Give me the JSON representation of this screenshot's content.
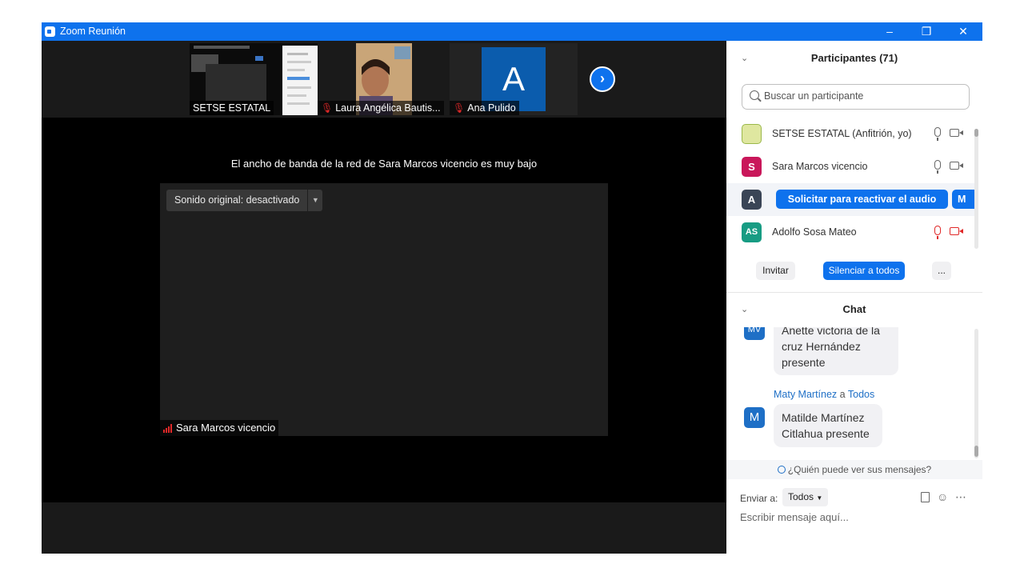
{
  "window": {
    "title": "Zoom Reunión"
  },
  "titlebar": {
    "minimize_icon": "minimize-icon",
    "restore_icon": "restore-icon",
    "close_icon": "close-icon"
  },
  "thumbnails": [
    {
      "name": "SETSE ESTATAL",
      "muted": false
    },
    {
      "name": "Laura Angélica Bautis...",
      "muted": true
    },
    {
      "name": "Ana Pulido",
      "muted": true,
      "avatar_letter": "A"
    }
  ],
  "meeting": {
    "bandwidth_notice": "El ancho de banda de la red de Sara Marcos vicencio es muy bajo",
    "original_sound": "Sonido original: desactivado",
    "speaker_name": "Sara Marcos vicencio"
  },
  "participants": {
    "title": "Participantes (71)",
    "search_placeholder": "Buscar un participante",
    "list": [
      {
        "name": "SETSE ESTATAL (Anfitrión, yo)",
        "avatar": "",
        "color": "#c8d96a"
      },
      {
        "name": "Sara Marcos vicencio",
        "avatar": "S",
        "color": "#c9175a"
      },
      {
        "name": "",
        "avatar": "A",
        "color": "#3a4556"
      },
      {
        "name": "Adolfo Sosa Mateo",
        "avatar": "AS",
        "color": "#179c83"
      }
    ],
    "request_audio_label": "Solicitar para reactivar el audio",
    "request_more_label": "M",
    "invite_label": "Invitar",
    "mute_all_label": "Silenciar a todos",
    "more_label": "..."
  },
  "chat": {
    "title": "Chat",
    "messages": [
      {
        "avatar": "MV",
        "text_lines": [
          "Anette victoria de la",
          "cruz Hernández",
          "presente"
        ]
      },
      {
        "sender": "Maty Martínez",
        "connector": "a",
        "recipient": "Todos",
        "avatar": "M",
        "text_lines": [
          "Matilde Martínez",
          "Citlahua presente"
        ]
      }
    ],
    "who_can_see": "¿Quién puede ver sus mensajes?",
    "send_to_label": "Enviar a:",
    "send_to_value": "Todos",
    "input_placeholder": "Escribir mensaje aquí..."
  },
  "colors": {
    "accent": "#0e72ed",
    "muted_red": "#e02828"
  }
}
